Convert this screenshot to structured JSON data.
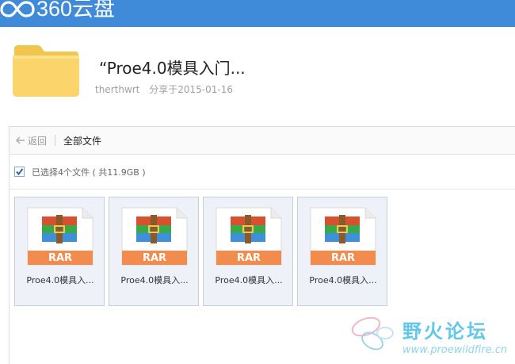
{
  "app": {
    "brand_name": "360云盘",
    "header_color": "#3f8bd9"
  },
  "share": {
    "title": "“Proe4.0模具入门...",
    "user": "therthwrt",
    "date_label": "分享于2015-01-16",
    "folder_icon": "folder-icon"
  },
  "toolbar": {
    "back_label": "返回",
    "breadcrumb": "全部文件"
  },
  "selection": {
    "checked": true,
    "summary": "已选择4个文件 ( 共11.9GB )"
  },
  "files": [
    {
      "badge": "RAR",
      "name": "Proe4.0模具入...",
      "icon": "rar-archive-icon"
    },
    {
      "badge": "RAR",
      "name": "Proe4.0模具入...",
      "icon": "rar-archive-icon"
    },
    {
      "badge": "RAR",
      "name": "Proe4.0模具入...",
      "icon": "rar-archive-icon"
    },
    {
      "badge": "RAR",
      "name": "Proe4.0模具入...",
      "icon": "rar-archive-icon"
    }
  ],
  "watermark": {
    "title": "野火论坛",
    "url": "www.proewildfire.cn"
  }
}
